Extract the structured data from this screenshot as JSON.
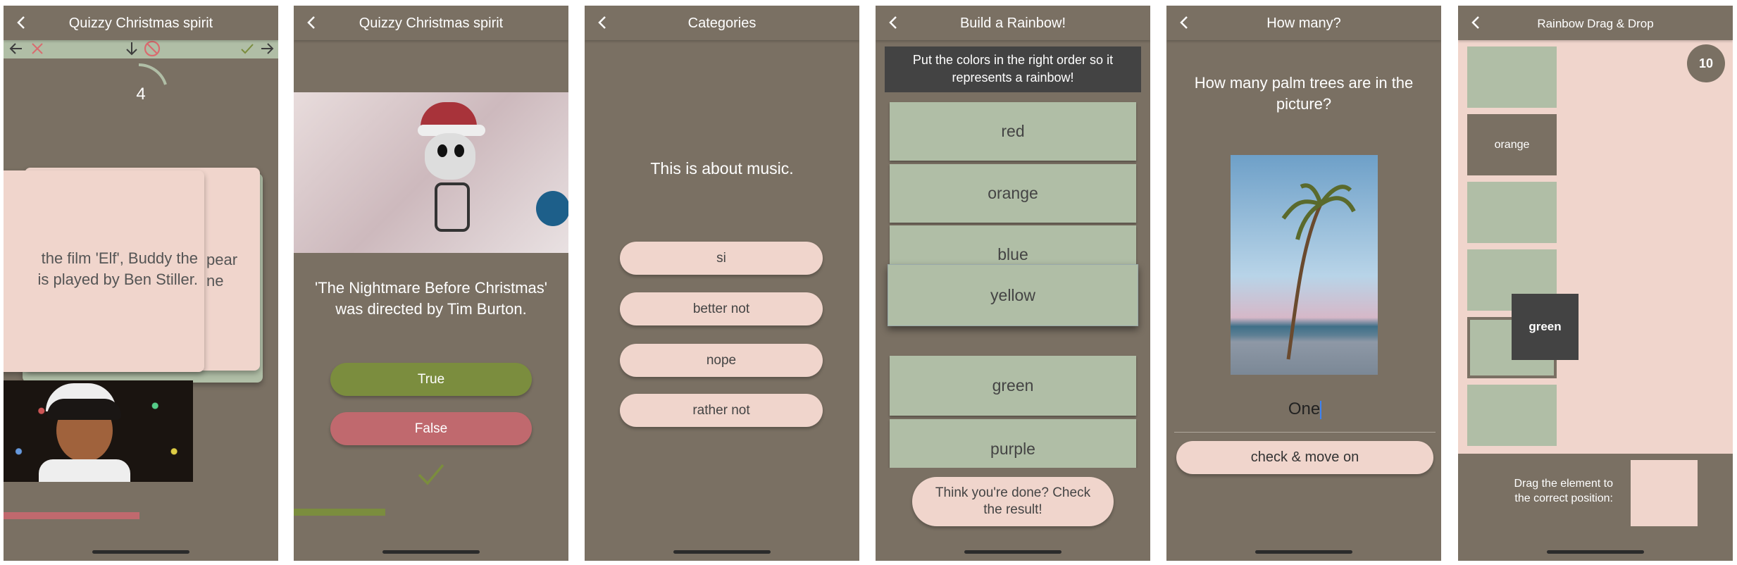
{
  "colors": {
    "background": "#7a7063",
    "sage": "#b0bea6",
    "pink": "#f0d5cc",
    "dark": "#434343",
    "olive": "#7b8d3e",
    "red": "#c0696e"
  },
  "screens": [
    {
      "title": "Quizzy Christmas spirit",
      "back_icon": "chevron-left-icon",
      "swipe_bar": {
        "icons": [
          "arrow-left-icon",
          "close-icon",
          "arrow-down-icon",
          "prohibited-icon",
          "check-icon",
          "arrow-right-icon"
        ]
      },
      "timer": {
        "value": "4"
      },
      "front_card": {
        "lines": [
          "the film 'Elf', Buddy the",
          "is played by Ben Stiller."
        ]
      },
      "back_card": {
        "lines": [
          "pear",
          "ne"
        ]
      },
      "image": "elf-doll-photo",
      "progress": 0.49
    },
    {
      "title": "Quizzy Christmas spirit",
      "image": "jack-skellington-ornament-photo",
      "question": "'The Nightmare Before Christmas' was directed by Tim Burton.",
      "true_label": "True",
      "false_label": "False",
      "result_icon": "check-icon",
      "progress": 0.33
    },
    {
      "title": "Categories",
      "statement": "This is about music.",
      "options": [
        "si",
        "better not",
        "nope",
        "rather not"
      ]
    },
    {
      "title": "Build a Rainbow!",
      "instruction": "Put the colors in the right order so it represents a rainbow!",
      "items": [
        "red",
        "orange",
        "blue",
        "yellow",
        "green",
        "purple"
      ],
      "dragging": "yellow",
      "submit_label": "Think you're done? Check the result!"
    },
    {
      "title": "How many?",
      "question": "How many palm trees are in the picture?",
      "image": "palm-tree-beach-photo",
      "answer": "One",
      "submit_label": "check & move on"
    },
    {
      "title": "Rainbow Drag & Drop",
      "counter": "10",
      "placed": "orange",
      "dragging": "green",
      "hint": "Drag the element to the correct position:"
    }
  ]
}
